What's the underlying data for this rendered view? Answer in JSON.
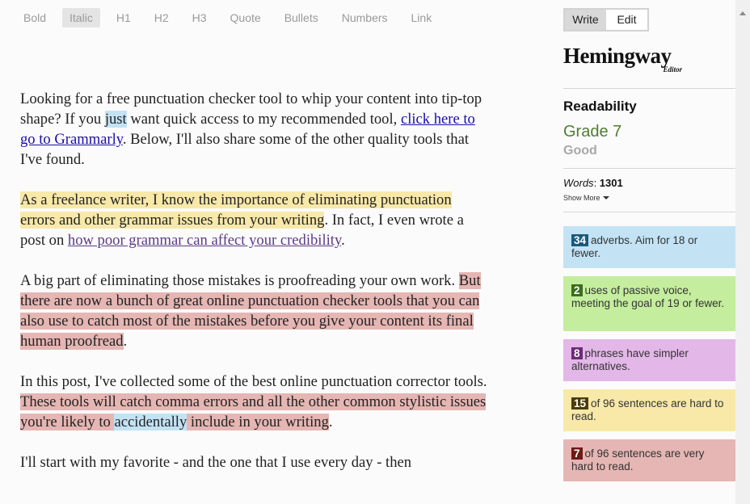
{
  "toolbar": {
    "items": [
      "Bold",
      "Italic",
      "H1",
      "H2",
      "H3",
      "Quote",
      "Bullets",
      "Numbers",
      "Link"
    ],
    "active": "Italic"
  },
  "editor": {
    "p1": {
      "a": "Looking for a free punctuation checker tool to whip your content into tip-top shape? If you ",
      "b": "just",
      "c": " want quick access to my recommended tool, ",
      "link": "click here to go to Grammarly",
      "d": ". Below, I'll also share some of the other quality tools that I've found."
    },
    "p2": {
      "a": "As a freelance writer, I know the importance of eliminating punctuation errors and other grammar issues from your writing",
      "b": ". In fact, I even wrote a post on ",
      "link": "how poor grammar can affect your credibility",
      "c": "."
    },
    "p3": {
      "a": "A big part of eliminating those mistakes is proofreading your own work. ",
      "b": "But there are now a bunch of great online punctuation checker tools that you can also use to catch most of the mistakes before you give your content its final human proofread",
      "c": "."
    },
    "p4": {
      "a": "In this post, I've collected some of the best online punctuation corrector tools. ",
      "b": "These tools will catch comma errors and all the other common stylistic issues you're likely to ",
      "c": "accidentally",
      "d": " include in your writing",
      "e": "."
    },
    "p5": {
      "a": "I'll start with my favorite - and the one that I use every day - then"
    }
  },
  "sidebar": {
    "mode_write": "Write",
    "mode_edit": "Edit",
    "logo_main": "Hemingway",
    "logo_sub": "Editor",
    "readability_label": "Readability",
    "grade": "Grade 7",
    "grade_desc": "Good",
    "words_label": "Words",
    "words_count": "1301",
    "show_more": "Show More"
  },
  "cards": {
    "adverbs": {
      "count": "34",
      "text": "adverbs. Aim for 18 or fewer."
    },
    "passive": {
      "count": "2",
      "text": "uses of passive voice, meeting the goal of 19 or fewer."
    },
    "phrases": {
      "count": "8",
      "text": "phrases have simpler alternatives."
    },
    "hard": {
      "count": "15",
      "text": "of 96 sentences are hard to read."
    },
    "veryhard": {
      "count": "7",
      "text": "of 96 sentences are very hard to read."
    }
  },
  "colors": {
    "adverb": "#c3e3f5",
    "passive": "#c4ed9d",
    "phrase": "#e3b7e8",
    "hard": "#f8e9a9",
    "very_hard": "#e5b6b3",
    "grade": "#4f7d2f"
  }
}
